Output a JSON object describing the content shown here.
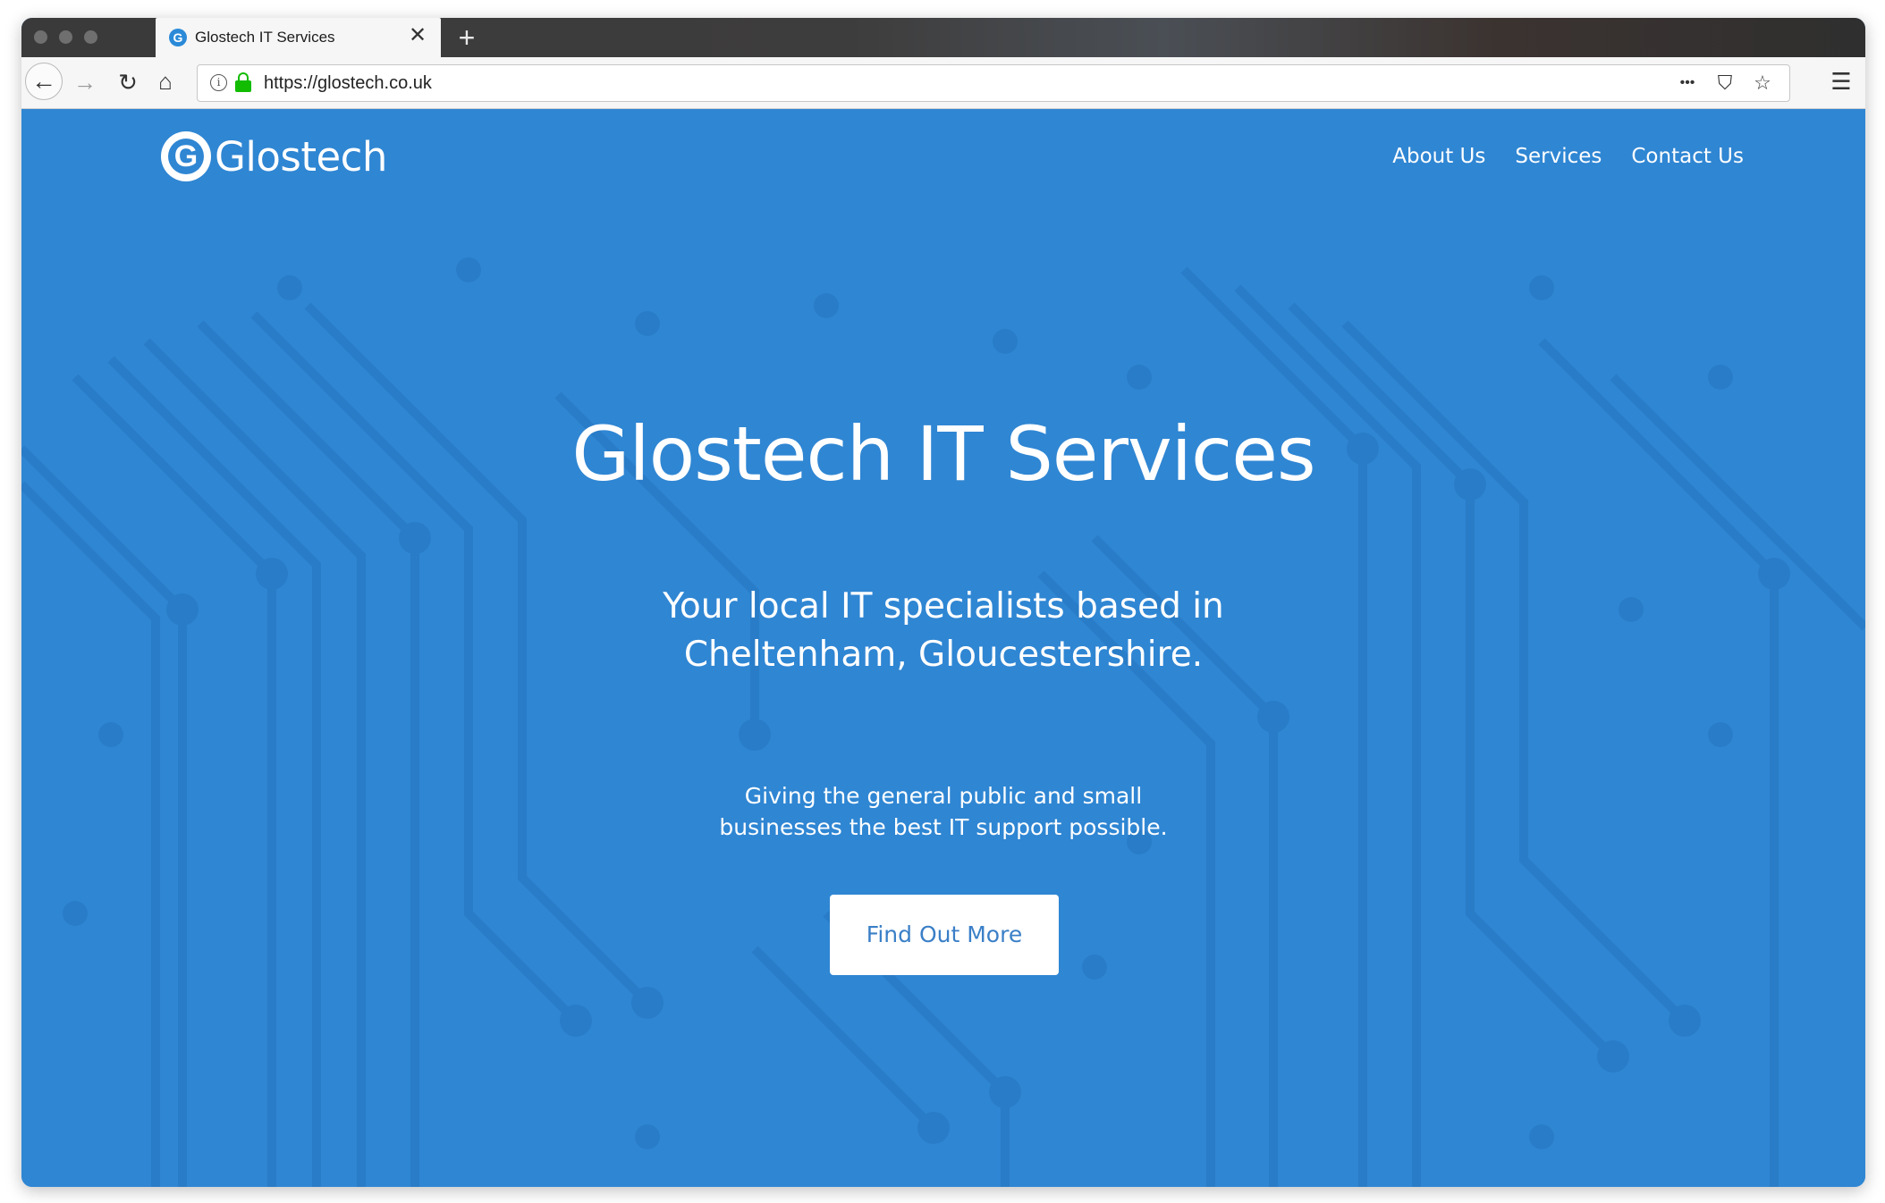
{
  "browser": {
    "tab": {
      "favicon_glyph": "G",
      "title": "Glostech IT Services",
      "close_glyph": "✕"
    },
    "new_tab_glyph": "+",
    "nav": {
      "back_glyph": "←",
      "forward_glyph": "→",
      "reload_glyph": "↻",
      "home_glyph": "⌂"
    },
    "urlbar": {
      "info_glyph": "i",
      "url": "https://glostech.co.uk",
      "more_glyph": "•••",
      "pocket_glyph": "⛉",
      "bookmark_glyph": "☆"
    },
    "menu_glyph": "☰",
    "icons": {
      "traffic_lights": [
        "traffic-light-icon",
        "traffic-light-icon",
        "traffic-light-icon"
      ],
      "lock_color": "#12bc00"
    }
  },
  "site": {
    "logo": {
      "mark_glyph": "G",
      "text": "Glostech"
    },
    "nav": [
      {
        "label": "About Us"
      },
      {
        "label": "Services"
      },
      {
        "label": "Contact Us"
      }
    ],
    "hero": {
      "title": "Glostech IT Services",
      "subtitle": "Your local IT specialists based in Cheltenham, Gloucestershire.",
      "text": "Giving the general public and small businesses the best IT support possible.",
      "cta_label": "Find Out More"
    },
    "colors": {
      "background": "#2f86d3",
      "cta_text": "#3a7fc7"
    }
  }
}
